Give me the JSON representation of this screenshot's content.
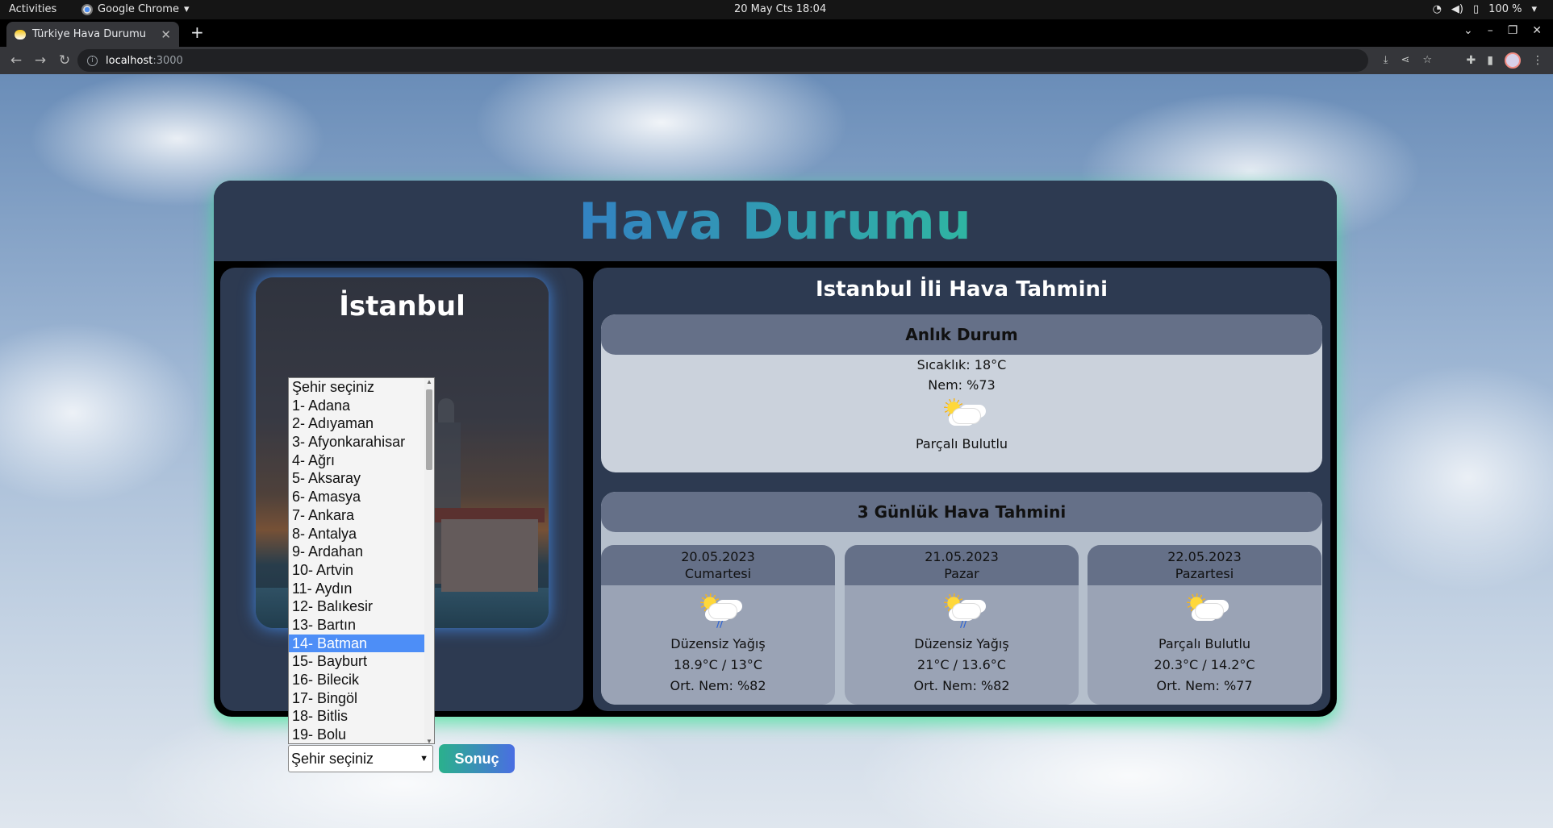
{
  "os": {
    "activities": "Activities",
    "app_name": "Google Chrome",
    "clock": "20 May Cts  18:04",
    "battery": "100 %"
  },
  "browser": {
    "tab_title": "Türkiye Hava Durumu",
    "url_host": "localhost",
    "url_port": ":3000"
  },
  "app": {
    "title": "Hava Durumu",
    "city_photo_label": "İstanbul",
    "city_select": {
      "selected": "Şehir seçiniz",
      "highlighted": "14- Batman",
      "options": [
        "Şehir seçiniz",
        "1- Adana",
        "2- Adıyaman",
        "3- Afyonkarahisar",
        "4- Ağrı",
        "5- Aksaray",
        "6- Amasya",
        "7- Ankara",
        "8- Antalya",
        "9- Ardahan",
        "10- Artvin",
        "11- Aydın",
        "12- Balıkesir",
        "13- Bartın",
        "14- Batman",
        "15- Bayburt",
        "16- Bilecik",
        "17- Bingöl",
        "18- Bitlis",
        "19- Bolu"
      ]
    },
    "submit_label": "Sonuç",
    "forecast_title": "Istanbul İli Hava Tahmini",
    "current": {
      "heading": "Anlık Durum",
      "temperature": "Sıcaklık: 18°C",
      "humidity": "Nem: %73",
      "icon": "partly-cloudy-icon",
      "condition": "Parçalı Bulutlu"
    },
    "three_day": {
      "heading": "3 Günlük Hava Tahmini",
      "days": [
        {
          "date": "20.05.2023",
          "weekday": "Cumartesi",
          "icon": "sun-cloud-rain-icon",
          "condition": "Düzensiz Yağış",
          "temps": "18.9°C / 13°C",
          "humidity": "Ort. Nem: %82"
        },
        {
          "date": "21.05.2023",
          "weekday": "Pazar",
          "icon": "sun-cloud-rain-icon",
          "condition": "Düzensiz Yağış",
          "temps": "21°C / 13.6°C",
          "humidity": "Ort. Nem: %82"
        },
        {
          "date": "22.05.2023",
          "weekday": "Pazartesi",
          "icon": "partly-cloudy-icon",
          "condition": "Parçalı Bulutlu",
          "temps": "20.3°C / 14.2°C",
          "humidity": "Ort. Nem: %77"
        }
      ]
    }
  }
}
